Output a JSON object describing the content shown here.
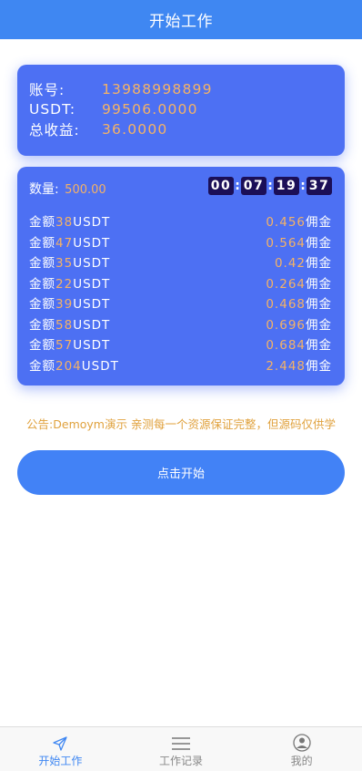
{
  "header": {
    "title": "开始工作"
  },
  "account": {
    "rows": [
      {
        "label": "账号:",
        "value": "13988998899"
      },
      {
        "label": "USDT:",
        "value": "99506.0000"
      },
      {
        "label": "总收益:",
        "value": "36.0000"
      }
    ]
  },
  "task": {
    "qty_label": "数量:",
    "qty_value": "500.00",
    "timer": [
      "00",
      "07",
      "19",
      "37"
    ],
    "timer_sep": ":",
    "rows": [
      {
        "prefix": "金额",
        "amount": "38",
        "unit": "USDT",
        "commission": "0.456",
        "suffix": "佣金"
      },
      {
        "prefix": "金额",
        "amount": "47",
        "unit": "USDT",
        "commission": "0.564",
        "suffix": "佣金"
      },
      {
        "prefix": "金额",
        "amount": "35",
        "unit": "USDT",
        "commission": "0.42",
        "suffix": "佣金"
      },
      {
        "prefix": "金额",
        "amount": "22",
        "unit": "USDT",
        "commission": "0.264",
        "suffix": "佣金"
      },
      {
        "prefix": "金额",
        "amount": "39",
        "unit": "USDT",
        "commission": "0.468",
        "suffix": "佣金"
      },
      {
        "prefix": "金额",
        "amount": "58",
        "unit": "USDT",
        "commission": "0.696",
        "suffix": "佣金"
      },
      {
        "prefix": "金额",
        "amount": "57",
        "unit": "USDT",
        "commission": "0.684",
        "suffix": "佣金"
      },
      {
        "prefix": "金额",
        "amount": "204",
        "unit": "USDT",
        "commission": "2.448",
        "suffix": "佣金"
      }
    ]
  },
  "notice": "公告:Demoym演示 亲测每一个资源保证完整，但源码仅供学",
  "start_button": "点击开始",
  "tabbar": {
    "tabs": [
      {
        "label": "开始工作",
        "icon": "send-icon",
        "active": true
      },
      {
        "label": "工作记录",
        "icon": "menu-icon",
        "active": false
      },
      {
        "label": "我的",
        "icon": "user-icon",
        "active": false
      }
    ]
  },
  "colors": {
    "primary": "#3f87f2",
    "card": "#4d70f3",
    "highlight": "#f4b266",
    "timer_bg": "#1b0f57",
    "notice": "#e0a23e"
  }
}
